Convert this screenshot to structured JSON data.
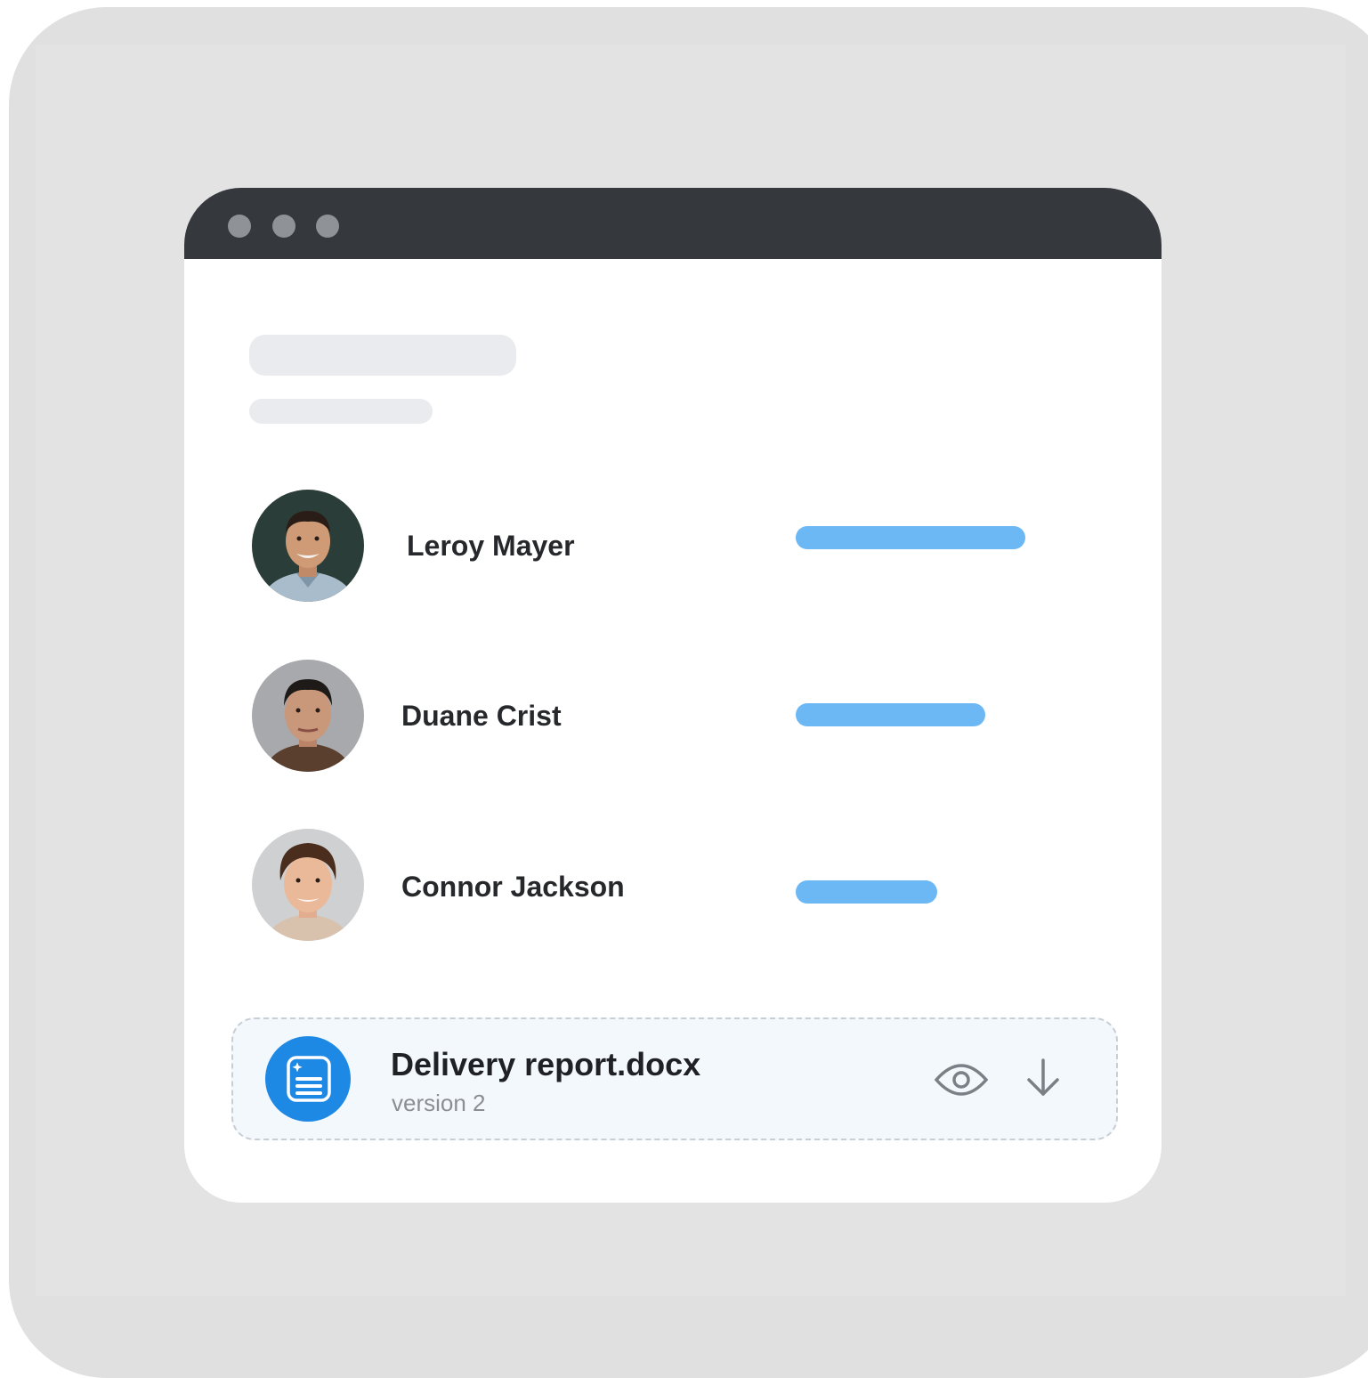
{
  "people": [
    {
      "name": "Leroy Mayer",
      "bar_fraction": 0.86
    },
    {
      "name": "Duane Crist",
      "bar_fraction": 0.71
    },
    {
      "name": "Connor Jackson",
      "bar_fraction": 0.53
    }
  ],
  "file": {
    "name": "Delivery report.docx",
    "version": "version 2",
    "icon": "document-icon",
    "actions": [
      "eye-icon",
      "download-arrow-icon"
    ]
  },
  "colors": {
    "titlebar": "#35383d",
    "bar": "#6cb8f5",
    "file_icon_bg": "#1e88e5"
  }
}
